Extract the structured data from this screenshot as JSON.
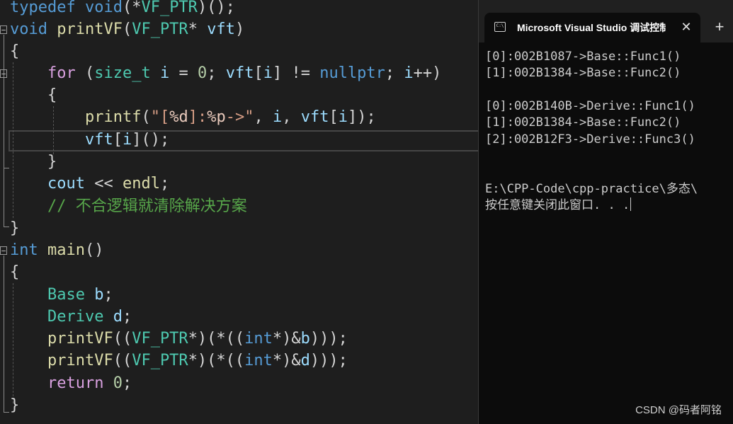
{
  "editor": {
    "lines": [
      [
        "typedef",
        " ",
        "void",
        "(*",
        "VF_PTR",
        ")();"
      ],
      [
        "void",
        " ",
        "printVF",
        "(",
        "VF_PTR",
        "* ",
        "vft",
        ")"
      ],
      [
        "{"
      ],
      [
        "    ",
        "for",
        " (",
        "size_t",
        " ",
        "i",
        " = ",
        "0",
        "; ",
        "vft",
        "[",
        "i",
        "] != ",
        "nullptr",
        "; ",
        "i",
        "++)"
      ],
      [
        "    ",
        "{"
      ],
      [
        "        ",
        "printf",
        "(",
        "\"[",
        "%d",
        "]:",
        "%p",
        "->\"",
        ", ",
        "i",
        ", ",
        "vft",
        "[",
        "i",
        "]);"
      ],
      [
        "        ",
        "vft",
        "[",
        "i",
        "]();"
      ],
      [
        "    ",
        "}"
      ],
      [
        "    ",
        "cout",
        " << ",
        "endl",
        ";"
      ],
      [
        "    ",
        "// 不合逻辑就清除解决方案"
      ],
      [
        "}"
      ],
      [
        "int",
        " ",
        "main",
        "()"
      ],
      [
        "{"
      ],
      [
        "    ",
        "Base",
        " ",
        "b",
        ";"
      ],
      [
        "    ",
        "Derive",
        " ",
        "d",
        ";"
      ],
      [
        "    ",
        "printVF",
        "((",
        "VF_PTR",
        "*)(*((",
        "int",
        "*)&",
        "b",
        ")));"
      ],
      [
        "    ",
        "printVF",
        "((",
        "VF_PTR",
        "*)(*((",
        "int",
        "*)&",
        "d",
        ")));"
      ],
      [
        "    ",
        "return",
        " ",
        "0",
        ";"
      ],
      [
        "}"
      ]
    ]
  },
  "console": {
    "tab_title": "Microsoft Visual Studio 调试控制台",
    "tab_icon": "terminal-icon",
    "close_glyph": "✕",
    "new_tab_glyph": "+",
    "lines": [
      "[0]:002B1087->Base::Func1()",
      "[1]:002B1384->Base::Func2()",
      "",
      "[0]:002B140B->Derive::Func1()",
      "[1]:002B1384->Base::Func2()",
      "[2]:002B12F3->Derive::Func3()",
      "",
      "",
      "E:\\CPP-Code\\cpp-practice\\多态\\",
      "按任意键关闭此窗口. . ."
    ]
  },
  "watermark": "CSDN @码者阿铭",
  "colors": {
    "editor_bg": "#1e1e1e",
    "console_bg": "#0c0c0c",
    "keyword": "#569cd6",
    "control_keyword": "#d8a0df",
    "function": "#dcdcaa",
    "type": "#4ec9b0",
    "variable": "#9cdcfe",
    "string": "#d69d85",
    "number": "#b5cea8",
    "comment": "#57a64a"
  }
}
